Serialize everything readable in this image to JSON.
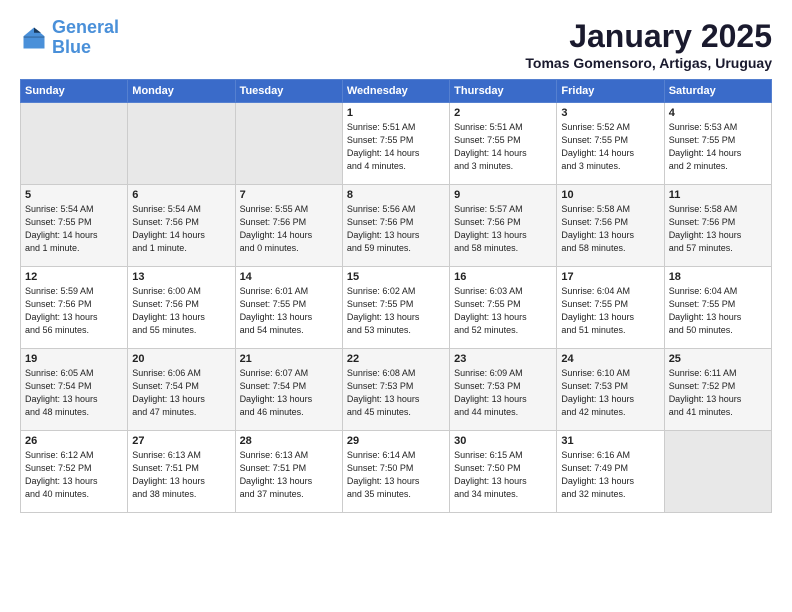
{
  "logo": {
    "text1": "General",
    "text2": "Blue"
  },
  "title": "January 2025",
  "subtitle": "Tomas Gomensoro, Artigas, Uruguay",
  "weekdays": [
    "Sunday",
    "Monday",
    "Tuesday",
    "Wednesday",
    "Thursday",
    "Friday",
    "Saturday"
  ],
  "weeks": [
    [
      {
        "day": "",
        "info": ""
      },
      {
        "day": "",
        "info": ""
      },
      {
        "day": "",
        "info": ""
      },
      {
        "day": "1",
        "info": "Sunrise: 5:51 AM\nSunset: 7:55 PM\nDaylight: 14 hours\nand 4 minutes."
      },
      {
        "day": "2",
        "info": "Sunrise: 5:51 AM\nSunset: 7:55 PM\nDaylight: 14 hours\nand 3 minutes."
      },
      {
        "day": "3",
        "info": "Sunrise: 5:52 AM\nSunset: 7:55 PM\nDaylight: 14 hours\nand 3 minutes."
      },
      {
        "day": "4",
        "info": "Sunrise: 5:53 AM\nSunset: 7:55 PM\nDaylight: 14 hours\nand 2 minutes."
      }
    ],
    [
      {
        "day": "5",
        "info": "Sunrise: 5:54 AM\nSunset: 7:55 PM\nDaylight: 14 hours\nand 1 minute."
      },
      {
        "day": "6",
        "info": "Sunrise: 5:54 AM\nSunset: 7:56 PM\nDaylight: 14 hours\nand 1 minute."
      },
      {
        "day": "7",
        "info": "Sunrise: 5:55 AM\nSunset: 7:56 PM\nDaylight: 14 hours\nand 0 minutes."
      },
      {
        "day": "8",
        "info": "Sunrise: 5:56 AM\nSunset: 7:56 PM\nDaylight: 13 hours\nand 59 minutes."
      },
      {
        "day": "9",
        "info": "Sunrise: 5:57 AM\nSunset: 7:56 PM\nDaylight: 13 hours\nand 58 minutes."
      },
      {
        "day": "10",
        "info": "Sunrise: 5:58 AM\nSunset: 7:56 PM\nDaylight: 13 hours\nand 58 minutes."
      },
      {
        "day": "11",
        "info": "Sunrise: 5:58 AM\nSunset: 7:56 PM\nDaylight: 13 hours\nand 57 minutes."
      }
    ],
    [
      {
        "day": "12",
        "info": "Sunrise: 5:59 AM\nSunset: 7:56 PM\nDaylight: 13 hours\nand 56 minutes."
      },
      {
        "day": "13",
        "info": "Sunrise: 6:00 AM\nSunset: 7:56 PM\nDaylight: 13 hours\nand 55 minutes."
      },
      {
        "day": "14",
        "info": "Sunrise: 6:01 AM\nSunset: 7:55 PM\nDaylight: 13 hours\nand 54 minutes."
      },
      {
        "day": "15",
        "info": "Sunrise: 6:02 AM\nSunset: 7:55 PM\nDaylight: 13 hours\nand 53 minutes."
      },
      {
        "day": "16",
        "info": "Sunrise: 6:03 AM\nSunset: 7:55 PM\nDaylight: 13 hours\nand 52 minutes."
      },
      {
        "day": "17",
        "info": "Sunrise: 6:04 AM\nSunset: 7:55 PM\nDaylight: 13 hours\nand 51 minutes."
      },
      {
        "day": "18",
        "info": "Sunrise: 6:04 AM\nSunset: 7:55 PM\nDaylight: 13 hours\nand 50 minutes."
      }
    ],
    [
      {
        "day": "19",
        "info": "Sunrise: 6:05 AM\nSunset: 7:54 PM\nDaylight: 13 hours\nand 48 minutes."
      },
      {
        "day": "20",
        "info": "Sunrise: 6:06 AM\nSunset: 7:54 PM\nDaylight: 13 hours\nand 47 minutes."
      },
      {
        "day": "21",
        "info": "Sunrise: 6:07 AM\nSunset: 7:54 PM\nDaylight: 13 hours\nand 46 minutes."
      },
      {
        "day": "22",
        "info": "Sunrise: 6:08 AM\nSunset: 7:53 PM\nDaylight: 13 hours\nand 45 minutes."
      },
      {
        "day": "23",
        "info": "Sunrise: 6:09 AM\nSunset: 7:53 PM\nDaylight: 13 hours\nand 44 minutes."
      },
      {
        "day": "24",
        "info": "Sunrise: 6:10 AM\nSunset: 7:53 PM\nDaylight: 13 hours\nand 42 minutes."
      },
      {
        "day": "25",
        "info": "Sunrise: 6:11 AM\nSunset: 7:52 PM\nDaylight: 13 hours\nand 41 minutes."
      }
    ],
    [
      {
        "day": "26",
        "info": "Sunrise: 6:12 AM\nSunset: 7:52 PM\nDaylight: 13 hours\nand 40 minutes."
      },
      {
        "day": "27",
        "info": "Sunrise: 6:13 AM\nSunset: 7:51 PM\nDaylight: 13 hours\nand 38 minutes."
      },
      {
        "day": "28",
        "info": "Sunrise: 6:13 AM\nSunset: 7:51 PM\nDaylight: 13 hours\nand 37 minutes."
      },
      {
        "day": "29",
        "info": "Sunrise: 6:14 AM\nSunset: 7:50 PM\nDaylight: 13 hours\nand 35 minutes."
      },
      {
        "day": "30",
        "info": "Sunrise: 6:15 AM\nSunset: 7:50 PM\nDaylight: 13 hours\nand 34 minutes."
      },
      {
        "day": "31",
        "info": "Sunrise: 6:16 AM\nSunset: 7:49 PM\nDaylight: 13 hours\nand 32 minutes."
      },
      {
        "day": "",
        "info": ""
      }
    ]
  ]
}
